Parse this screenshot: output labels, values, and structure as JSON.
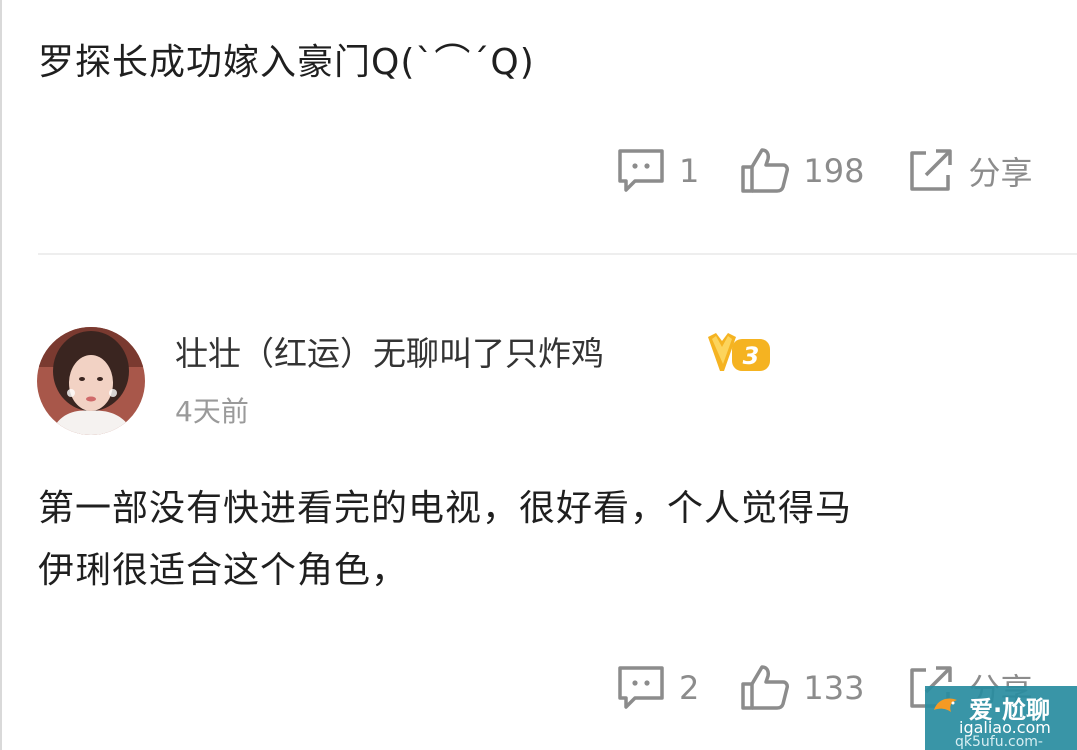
{
  "comments": [
    {
      "text_lines": [
        "罗探长成功嫁入豪门Q(`⌒´Q)"
      ],
      "actions": {
        "reply_count": "1",
        "like_count": "198",
        "share_label": "分享"
      }
    },
    {
      "username": "壮壮（红运）无聊叫了只炸鸡",
      "vip_level": "3",
      "timestamp": "4天前",
      "text_lines": [
        "第一部没有快进看完的电视，很好看，个人觉得马",
        "伊琍很适合这个角色，"
      ],
      "actions": {
        "reply_count": "2",
        "like_count": "133",
        "share_label": "分享"
      }
    }
  ],
  "watermark": {
    "line1": "爱·尬聊",
    "line2": "igaliao.com",
    "line3": "qk5ufu.com-"
  },
  "colors": {
    "text": "#1f1f1f",
    "muted": "#8c8c8c",
    "timestamp": "#9a9a9a",
    "divider": "#eeeeee",
    "vip_gold": "#f5b321"
  },
  "icons": [
    "comment-icon",
    "thumbs-up-icon",
    "share-icon",
    "vip-badge-icon",
    "avatar"
  ]
}
